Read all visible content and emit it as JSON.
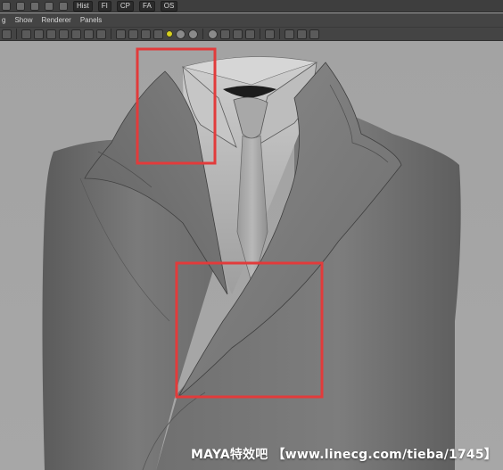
{
  "toolbar": {
    "tabs": [
      "Hist",
      "FI",
      "CP",
      "FA",
      "OS"
    ]
  },
  "menu": {
    "items": [
      "g",
      "Show",
      "Renderer",
      "Panels"
    ]
  },
  "watermark": {
    "text": "MAYA特效吧 【www.linecg.com/tieba/1745】"
  },
  "colors": {
    "viewport_bg": "#a5a5a5",
    "highlight_red": "#e23b3b",
    "menubar_bg": "#444444"
  }
}
